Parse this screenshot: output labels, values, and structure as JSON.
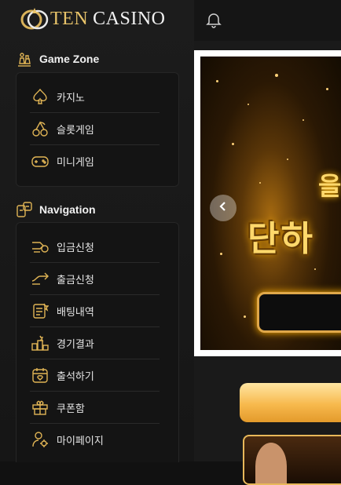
{
  "brand": {
    "logo_ten": "TEN",
    "logo_casino": "CASINO",
    "accent": "#e9c46a"
  },
  "sidebar": {
    "game_zone": {
      "title": "Game Zone",
      "icon": "chess-pieces-icon",
      "items": [
        {
          "label": "카지노",
          "icon": "spade-icon"
        },
        {
          "label": "슬롯게임",
          "icon": "cherry-icon"
        },
        {
          "label": "미니게임",
          "icon": "gamepad-icon"
        }
      ]
    },
    "navigation": {
      "title": "Navigation",
      "icon": "navigation-icon",
      "items": [
        {
          "label": "입금신청",
          "icon": "deposit-icon"
        },
        {
          "label": "출금신청",
          "icon": "withdraw-icon"
        },
        {
          "label": "배팅내역",
          "icon": "bet-history-icon"
        },
        {
          "label": "경기결과",
          "icon": "results-icon"
        },
        {
          "label": "출석하기",
          "icon": "calendar-icon"
        },
        {
          "label": "쿠폰함",
          "icon": "gift-icon"
        },
        {
          "label": "마이페이지",
          "icon": "user-gear-icon"
        }
      ]
    }
  },
  "topbar": {
    "icon": "bell-icon"
  },
  "banner": {
    "line1": "을",
    "line2": "단하",
    "prev_icon": "chevron-left-icon"
  }
}
